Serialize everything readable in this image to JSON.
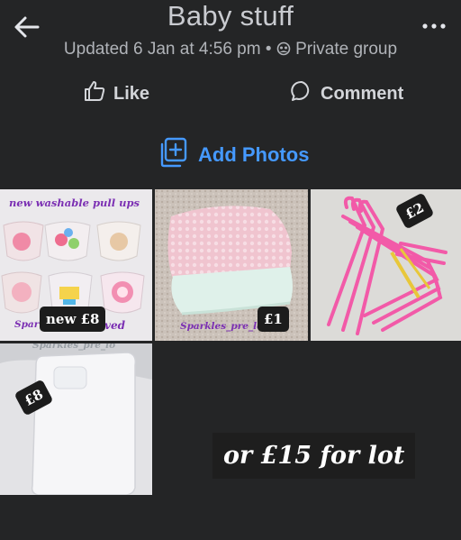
{
  "header": {
    "title": "Baby stuff",
    "subtitle_updated": "Updated 6 Jan at 4:56 pm",
    "separator": "•",
    "privacy_label": "Private group"
  },
  "actions": {
    "like_label": "Like",
    "comment_label": "Comment",
    "add_photos_label": "Add Photos"
  },
  "photos": [
    {
      "caption": "new washable pull ups",
      "watermark_left": "Spar",
      "watermark_right": "oved",
      "price_tag": "new £8"
    },
    {
      "watermark": "Sparkles_pre_lo",
      "price_tag": "£1"
    },
    {
      "price_tag": "£2"
    },
    {
      "watermark": "Sparkles_pre_lo",
      "price_tag": "£8"
    }
  ],
  "lot_note": "or £15 for lot",
  "colors": {
    "background": "#242526",
    "accent": "#4599ff",
    "watermark": "#7b2fb3"
  }
}
